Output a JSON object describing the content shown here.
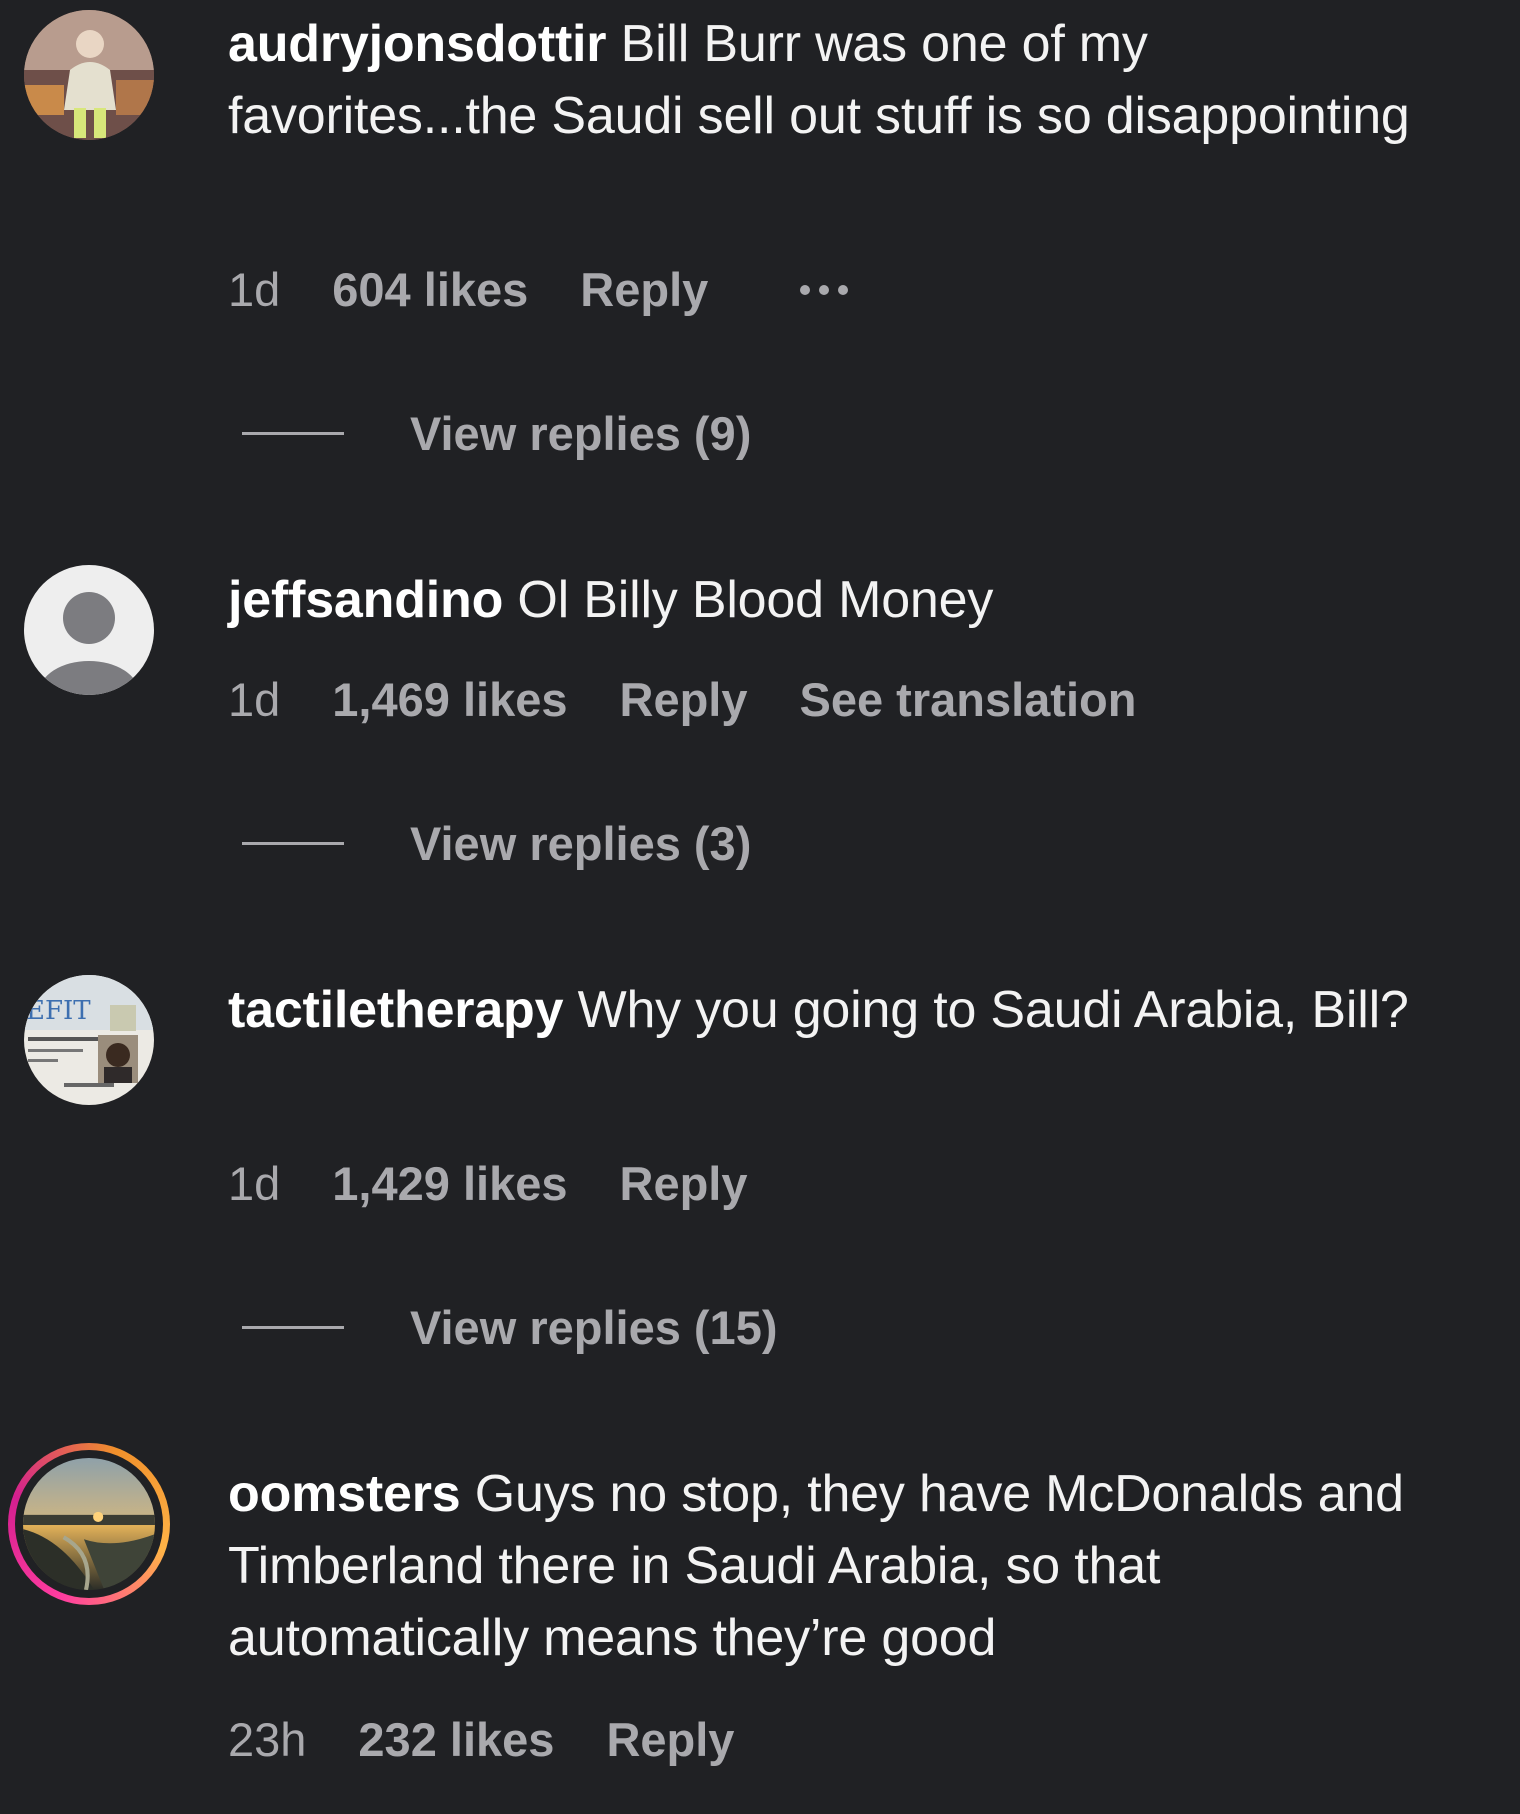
{
  "comments": [
    {
      "username": "audryjonsdottir",
      "text": "Bill Burr was one of my favorites...the Saudi sell out stuff is so disappointing",
      "time": "1d",
      "likes": "604 likes",
      "reply_label": "Reply",
      "view_replies": "View replies (9)"
    },
    {
      "username": "jeffsandino",
      "text": "Ol Billy Blood Money",
      "time": "1d",
      "likes": "1,469 likes",
      "reply_label": "Reply",
      "translation_label": "See translation",
      "view_replies": "View replies (3)"
    },
    {
      "username": "tactiletherapy",
      "text": "Why you going to Saudi Arabia, Bill?",
      "time": "1d",
      "likes": "1,429 likes",
      "reply_label": "Reply",
      "view_replies": "View replies (15)"
    },
    {
      "username": "oomsters",
      "text": "Guys no stop, they have McDonalds and Timberland there in Saudi Arabia, so that automatically means they’re good",
      "time": "23h",
      "likes": "232 likes",
      "reply_label": "Reply"
    }
  ],
  "icons": {
    "more": "more-options-icon",
    "default_avatar": "default-avatar-icon"
  },
  "colors": {
    "background": "#202124",
    "text": "#f3f3f3",
    "meta": "#a9a9ad",
    "story_ring_start": "#ff3da0",
    "story_ring_end": "#f0902b"
  }
}
